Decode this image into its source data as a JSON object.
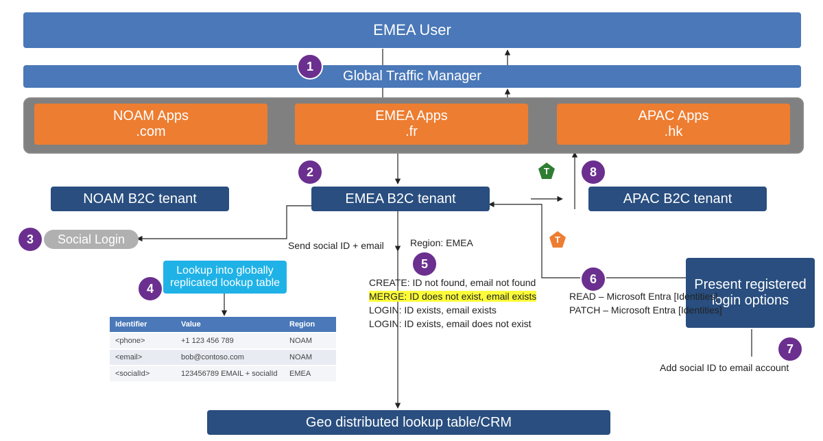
{
  "top": {
    "user": "EMEA User",
    "gtm": "Global Traffic Manager"
  },
  "apps": {
    "noam": {
      "line1": "NOAM Apps",
      "line2": ".com"
    },
    "emea": {
      "line1": "EMEA Apps",
      "line2": ".fr"
    },
    "apac": {
      "line1": "APAC Apps",
      "line2": ".hk"
    }
  },
  "tenants": {
    "noam": "NOAM B2C tenant",
    "emea": "EMEA B2C tenant",
    "apac": "APAC B2C tenant"
  },
  "social_login": "Social Login",
  "lookup_box": "Lookup into globally replicated lookup table",
  "present_box": "Present registered login options",
  "geo_box": "Geo distributed lookup table/CRM",
  "labels": {
    "send_social": "Send social ID + email",
    "region": "Region: EMEA",
    "create": "CREATE: ID not found, email not found",
    "merge": "MERGE: ID does not exist, email exists",
    "login1": "LOGIN: ID exists, email exists",
    "login2": "LOGIN: ID exists, email does not exist",
    "read": "READ – Microsoft Entra [Identities]",
    "patch": "PATCH – Microsoft Entra [Identities]",
    "add_social": "Add social ID to email account"
  },
  "badges": {
    "1": "1",
    "2": "2",
    "3": "3",
    "4": "4",
    "5": "5",
    "6": "6",
    "7": "7",
    "8": "8",
    "T": "T"
  },
  "table": {
    "h1": "Identifier",
    "h2": "Value",
    "h3": "Region",
    "rows": [
      {
        "id": "<phone>",
        "val": "+1 123 456 789",
        "reg": "NOAM"
      },
      {
        "id": "<email>",
        "val": "bob@contoso.com",
        "reg": "NOAM"
      },
      {
        "id": "<socialId>",
        "val": "123456789 EMAIL + socialId",
        "reg": "EMEA"
      }
    ]
  }
}
